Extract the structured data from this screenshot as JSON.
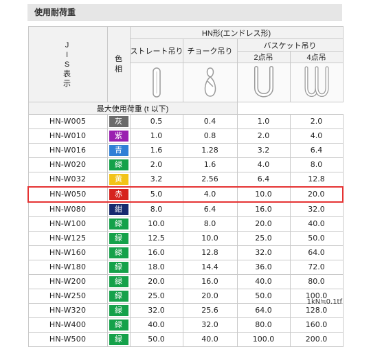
{
  "page_title": "使用耐荷重",
  "table": {
    "jis_header_chars": [
      "J",
      "I",
      "S",
      "表",
      "示"
    ],
    "color_header_chars": [
      "色",
      "相"
    ],
    "hn_group": "HN形(エンドレス形)",
    "straight": "ストレート吊り",
    "choke": "チョーク吊り",
    "basket": "バスケット吊り",
    "two_point": "2点吊",
    "four_point": "4点吊",
    "max_load": "最大使用荷重 (t 以下)",
    "rows": [
      {
        "jis": "HN-W005",
        "color_label": "灰",
        "color": "#6b6b6b",
        "straight": "0.5",
        "choke": "0.4",
        "two": "1.0",
        "four": "2.0"
      },
      {
        "jis": "HN-W010",
        "color_label": "紫",
        "color": "#9a1fb0",
        "straight": "1.0",
        "choke": "0.8",
        "two": "2.0",
        "four": "4.0"
      },
      {
        "jis": "HN-W016",
        "color_label": "青",
        "color": "#2f7fd6",
        "straight": "1.6",
        "choke": "1.28",
        "two": "3.2",
        "four": "6.4"
      },
      {
        "jis": "HN-W020",
        "color_label": "緑",
        "color": "#15a14a",
        "straight": "2.0",
        "choke": "1.6",
        "two": "4.0",
        "four": "8.0"
      },
      {
        "jis": "HN-W032",
        "color_label": "黄",
        "color": "#f2c318",
        "straight": "3.2",
        "choke": "2.56",
        "two": "6.4",
        "four": "12.8"
      },
      {
        "jis": "HN-W050",
        "color_label": "赤",
        "color": "#d6231e",
        "straight": "5.0",
        "choke": "4.0",
        "two": "10.0",
        "four": "20.0"
      },
      {
        "jis": "HN-W080",
        "color_label": "紺",
        "color": "#172a6e",
        "straight": "8.0",
        "choke": "6.4",
        "two": "16.0",
        "four": "32.0"
      },
      {
        "jis": "HN-W100",
        "color_label": "緑",
        "color": "#15a14a",
        "straight": "10.0",
        "choke": "8.0",
        "two": "20.0",
        "four": "40.0"
      },
      {
        "jis": "HN-W125",
        "color_label": "緑",
        "color": "#15a14a",
        "straight": "12.5",
        "choke": "10.0",
        "two": "25.0",
        "four": "50.0"
      },
      {
        "jis": "HN-W160",
        "color_label": "緑",
        "color": "#15a14a",
        "straight": "16.0",
        "choke": "12.8",
        "two": "32.0",
        "four": "64.0"
      },
      {
        "jis": "HN-W180",
        "color_label": "緑",
        "color": "#15a14a",
        "straight": "18.0",
        "choke": "14.4",
        "two": "36.0",
        "four": "72.0"
      },
      {
        "jis": "HN-W200",
        "color_label": "緑",
        "color": "#15a14a",
        "straight": "20.0",
        "choke": "16.0",
        "two": "40.0",
        "four": "80.0"
      },
      {
        "jis": "HN-W250",
        "color_label": "緑",
        "color": "#15a14a",
        "straight": "25.0",
        "choke": "20.0",
        "two": "50.0",
        "four": "100.0"
      },
      {
        "jis": "HN-W320",
        "color_label": "緑",
        "color": "#15a14a",
        "straight": "32.0",
        "choke": "25.6",
        "two": "64.0",
        "four": "128.0"
      },
      {
        "jis": "HN-W400",
        "color_label": "緑",
        "color": "#15a14a",
        "straight": "40.0",
        "choke": "32.0",
        "two": "80.0",
        "four": "160.0"
      },
      {
        "jis": "HN-W500",
        "color_label": "緑",
        "color": "#15a14a",
        "straight": "50.0",
        "choke": "40.0",
        "two": "100.0",
        "four": "200.0"
      }
    ],
    "highlight_row": "HN-W050",
    "highlight_color": "#e53333"
  },
  "footnote": "1kN≒0.1tf"
}
